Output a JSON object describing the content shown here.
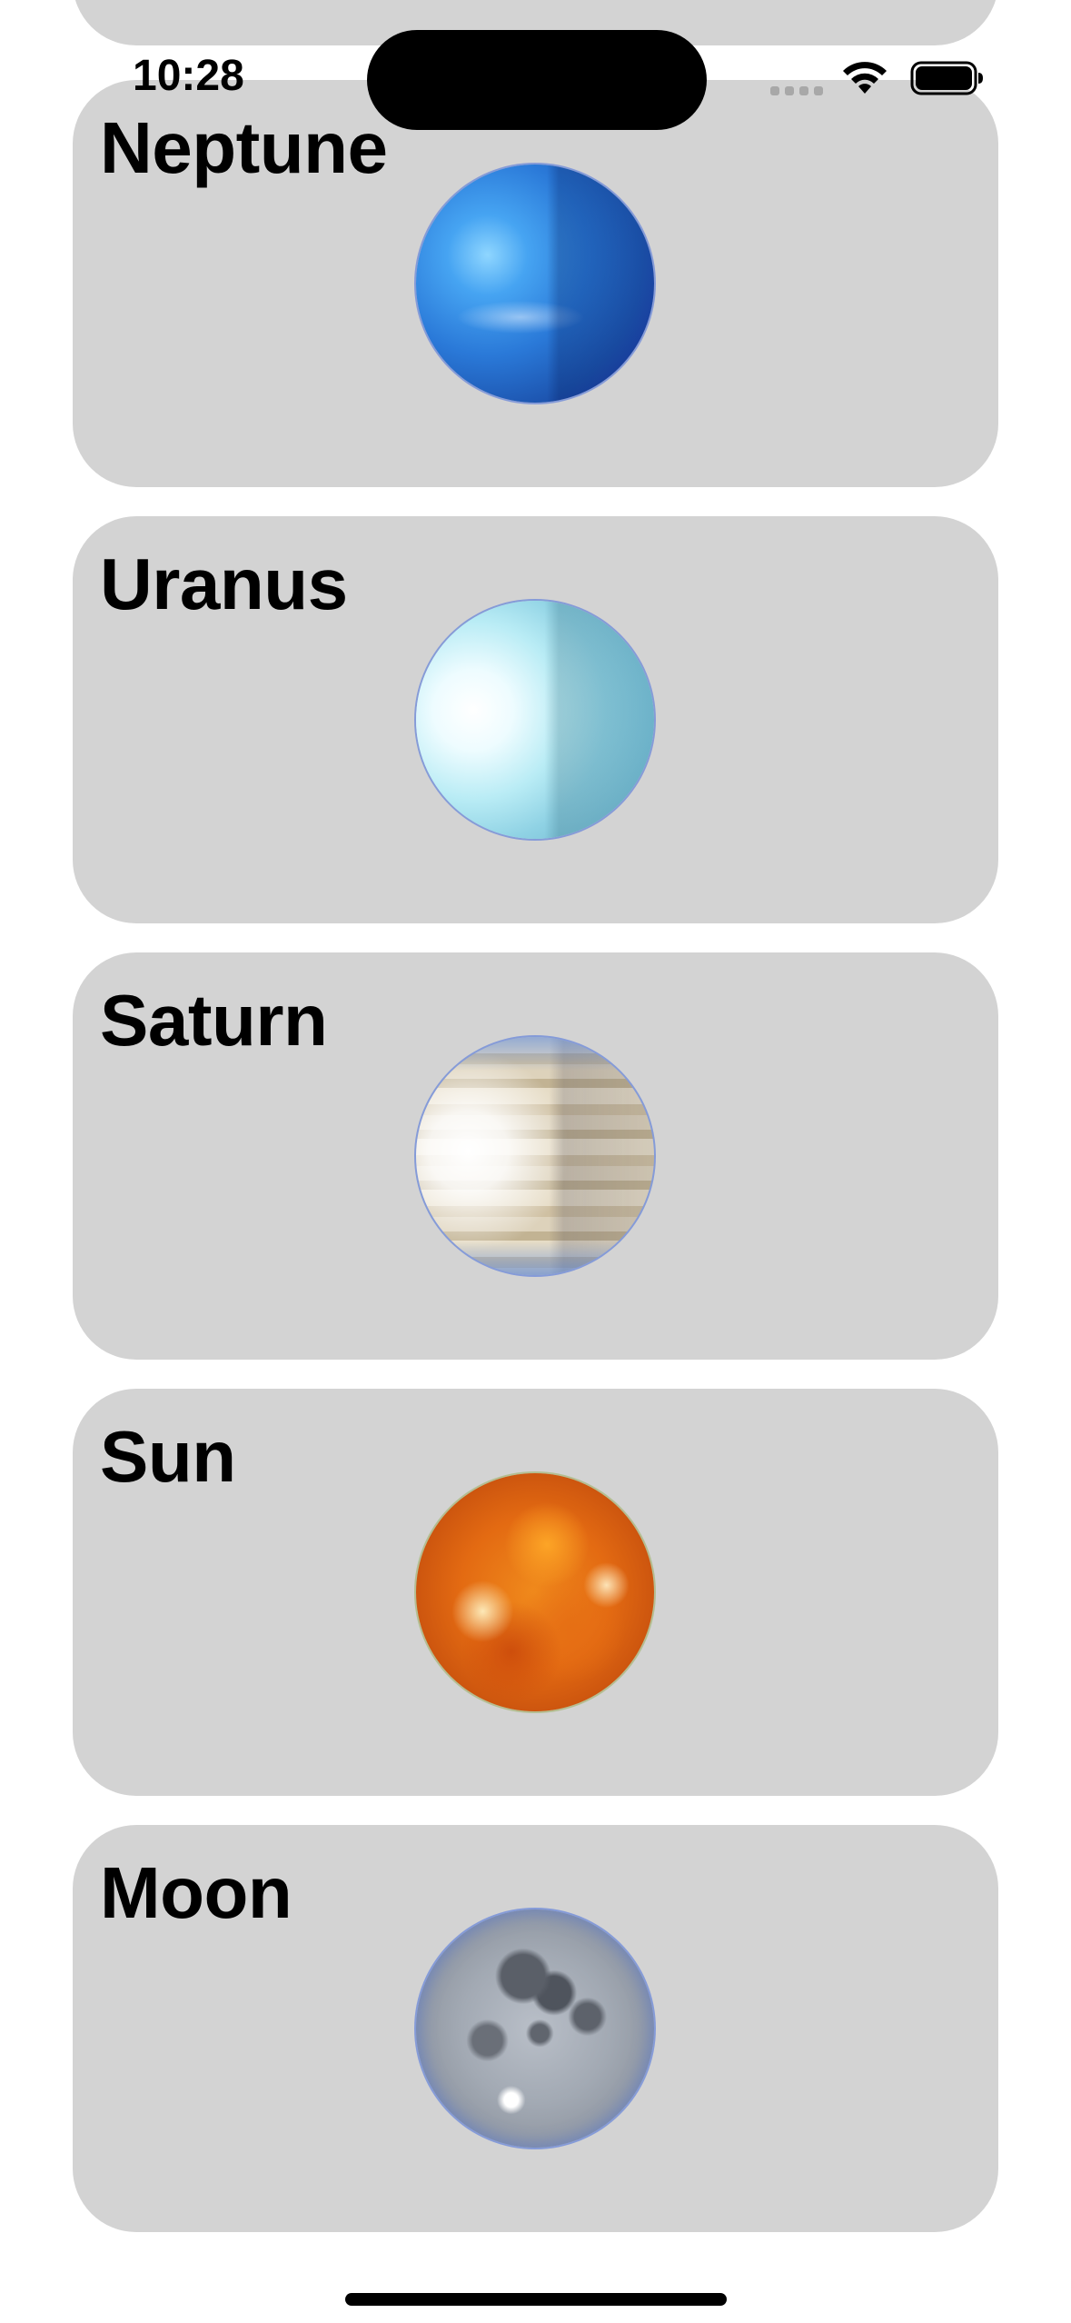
{
  "status_bar": {
    "time": "10:28"
  },
  "cards": [
    {
      "id": "partial",
      "title": "",
      "planet_icon": ""
    },
    {
      "id": "neptune",
      "title": "Neptune",
      "planet_icon": "neptune-globe"
    },
    {
      "id": "uranus",
      "title": "Uranus",
      "planet_icon": "uranus-globe"
    },
    {
      "id": "saturn",
      "title": "Saturn",
      "planet_icon": "saturn-globe"
    },
    {
      "id": "sun",
      "title": "Sun",
      "planet_icon": "sun-globe"
    },
    {
      "id": "moon",
      "title": "Moon",
      "planet_icon": "moon-globe"
    }
  ],
  "colors": {
    "card_background": "#d3d3d3",
    "page_background": "#ffffff",
    "text": "#000000"
  }
}
